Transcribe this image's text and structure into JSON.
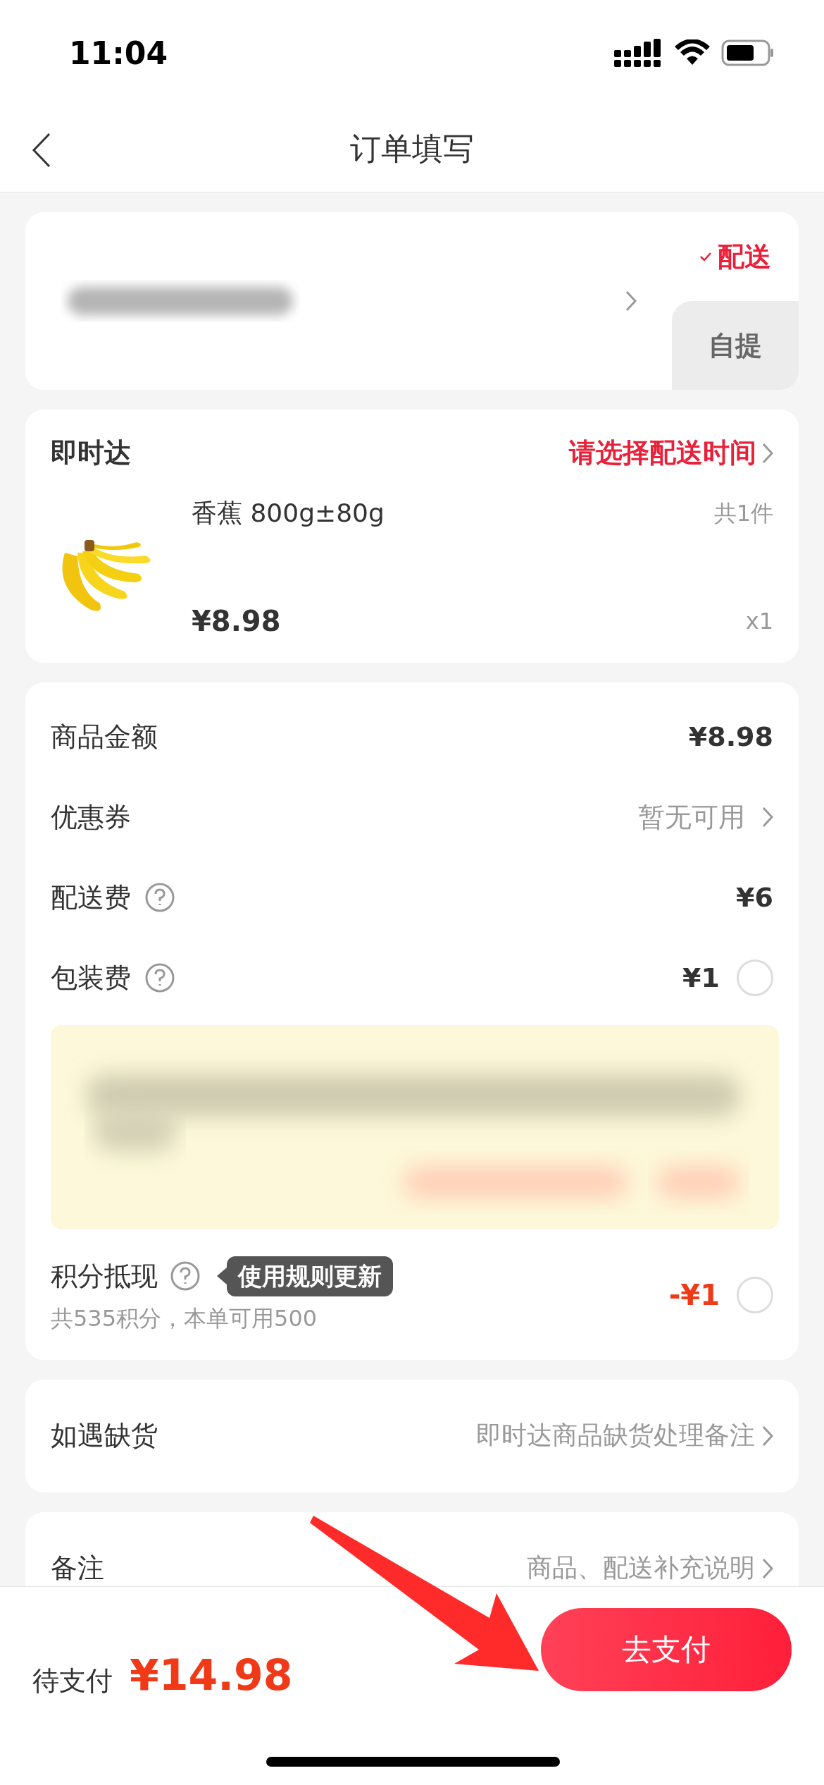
{
  "status_bar": {
    "time": "11:04"
  },
  "nav": {
    "title": "订单填写"
  },
  "delivery_options": [
    {
      "label": "配送",
      "selected": true
    },
    {
      "label": "自提",
      "selected": false
    }
  ],
  "shipment": {
    "title": "即时达",
    "time_prompt": "请选择配送时间",
    "product": {
      "name": "香蕉 800g±80g",
      "count": "共1件",
      "price": "¥8.98",
      "quantity": "x1"
    }
  },
  "fees": [
    {
      "kind": "amount",
      "label": "商品金额",
      "value": "¥8.98",
      "help": false
    },
    {
      "kind": "link",
      "label": "优惠券",
      "value": "暂无可用",
      "help": false
    },
    {
      "kind": "amount",
      "label": "配送费",
      "value": "¥6",
      "help": true
    },
    {
      "kind": "toggle",
      "label": "包装费",
      "value": "¥1",
      "help": true,
      "checked": false
    }
  ],
  "points": {
    "label": "积分抵现",
    "tooltip": "使用规则更新",
    "detail": "共535积分，本单可用500",
    "value": "-¥1",
    "checked": false
  },
  "out_of_stock": {
    "label": "如遇缺货",
    "value": "即时达商品缺货处理备注"
  },
  "remark": {
    "label": "备注",
    "value": "商品、配送补充说明"
  },
  "footer": {
    "label": "待支付",
    "total": "¥14.98",
    "pay_button": "去支付"
  }
}
